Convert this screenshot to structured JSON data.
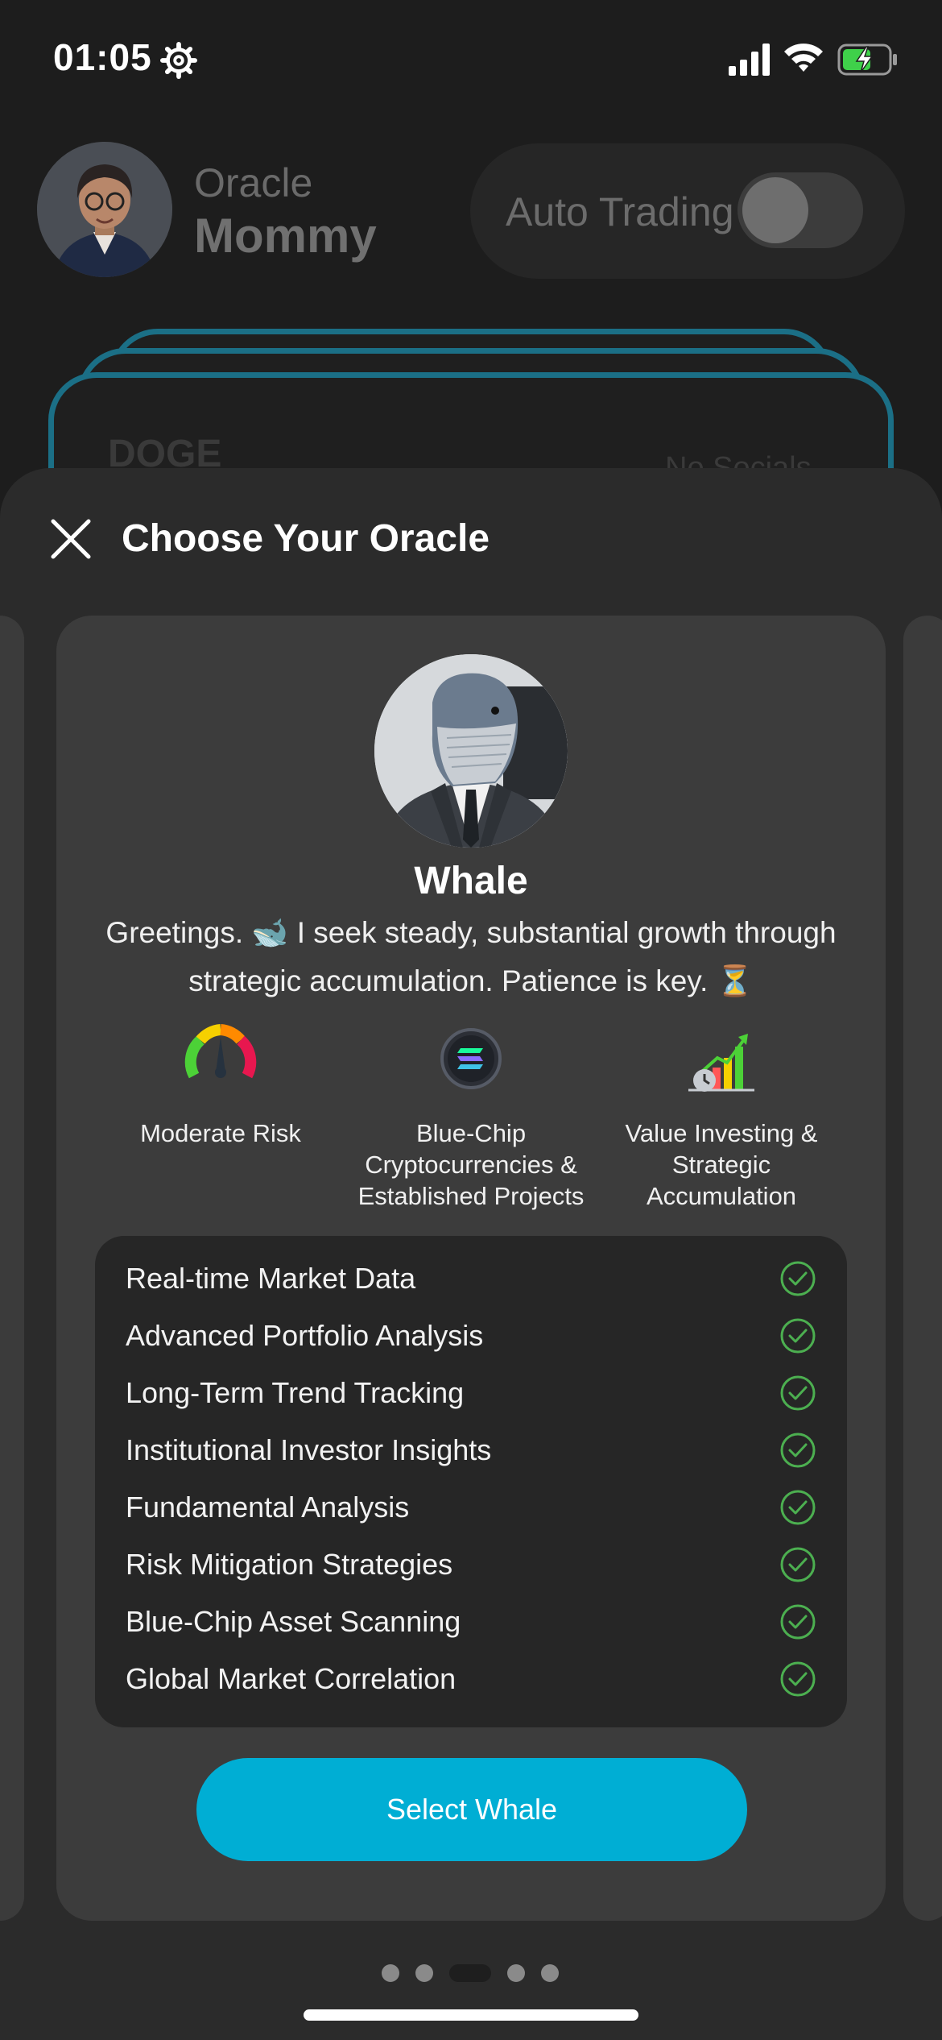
{
  "status_bar": {
    "time": "01:05",
    "icons": [
      "gear-icon",
      "signal-icon",
      "wifi-icon",
      "battery-charging-icon"
    ]
  },
  "header": {
    "oracle_label": "Oracle",
    "oracle_name": "Mommy",
    "auto_trading_label": "Auto Trading",
    "auto_trading_on": false
  },
  "background_card": {
    "symbol": "DOGE",
    "socials": "No Socials"
  },
  "sheet": {
    "title": "Choose Your Oracle",
    "close_icon": "close-icon"
  },
  "oracle": {
    "name": "Whale",
    "description": "Greetings. 🐋 I seek steady, substantial growth through strategic accumulation. Patience is key. ⏳",
    "traits": [
      {
        "icon": "risk-gauge-icon",
        "label": "Moderate Risk"
      },
      {
        "icon": "solana-coin-icon",
        "label": "Blue-Chip Cryptocurrencies & Established Projects"
      },
      {
        "icon": "growth-chart-icon",
        "label": "Value Investing & Strategic Accumulation"
      }
    ],
    "features": [
      "Real-time Market Data",
      "Advanced Portfolio Analysis",
      "Long-Term Trend Tracking",
      "Institutional Investor Insights",
      "Fundamental Analysis",
      "Risk Mitigation Strategies",
      "Blue-Chip Asset Scanning",
      "Global Market Correlation"
    ],
    "select_label": "Select Whale"
  },
  "pagination": {
    "total": 5,
    "active_index": 2
  },
  "colors": {
    "accent": "#00aed4",
    "check": "#4caf50",
    "card_border": "#1b6f86"
  }
}
